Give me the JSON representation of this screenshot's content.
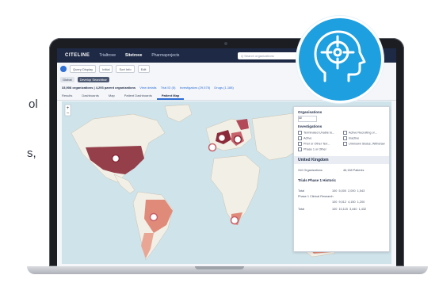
{
  "left_text": {
    "fragment_1": "ol",
    "fragment_2": "s,"
  },
  "app": {
    "logo": "CITELINE",
    "nav": [
      "Trialtrove",
      "Sitetrove",
      "Pharmaprojects"
    ],
    "active_nav_index": 1,
    "search_placeholder": "Q  Search organizations",
    "filter_row": [
      "Query Display",
      "Initial",
      "Sort Info",
      "Edit"
    ],
    "chips": [
      "Global",
      "Develop Searchbar"
    ],
    "count_text": "33,908 organizations | 4,293 parent organizations",
    "count_links": [
      "View details",
      "Trial ID (5)",
      "Investigators (29,575)",
      "Drugs (1,188)"
    ],
    "tabs": [
      "Results",
      "Dashboards",
      "Map",
      "Patient Dashboards",
      "Patient Map"
    ],
    "active_tab_index": 4
  },
  "panel": {
    "section_1": "Organisations",
    "box_1": "All",
    "section_2": "Investigations",
    "options_left": [
      "Terminated Unable to...",
      "Active",
      "Prior or Other Terr...",
      "Phase 1 or Other"
    ],
    "options_right": [
      "Active Recruiting or...",
      "Inactive",
      "Unknown Status, Withdraw"
    ],
    "country": "United Kingdom",
    "stat_labels": [
      "310 Organizations",
      "46,158 Patients"
    ],
    "sub_section": "Trials Phase 1 Historic",
    "table_rows": [
      [
        "Total",
        "100",
        "5,000",
        "2,000",
        "1,543"
      ],
      [
        "Phase 1 Clinical Research",
        "100",
        "9,012",
        "4,150",
        "1,200"
      ],
      [
        "Total",
        "100",
        "10,115",
        "3,440",
        "1,432"
      ]
    ]
  },
  "colors": {
    "badge": "#1d9fe0",
    "topbar": "#1e2a45",
    "heat_high": "#8b2b3a",
    "heat_mid": "#c7616b",
    "heat_low": "#e08a7a",
    "accent": "#2f6fd6"
  },
  "icons": {
    "badge_icon": "head-target-icon",
    "map_marker": "map-pin-icon"
  }
}
